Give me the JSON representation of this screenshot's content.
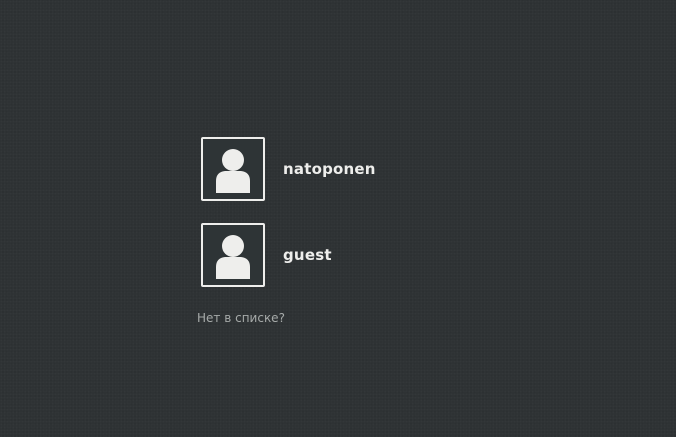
{
  "users": [
    {
      "name": "natoponen",
      "avatar_icon": "default-user-icon"
    },
    {
      "name": "guest",
      "avatar_icon": "default-user-icon"
    }
  ],
  "not_listed_label": "Нет в списке?",
  "colors": {
    "background": "#2e3234",
    "text": "#eeeeec",
    "muted_text": "#a6aaa9"
  }
}
